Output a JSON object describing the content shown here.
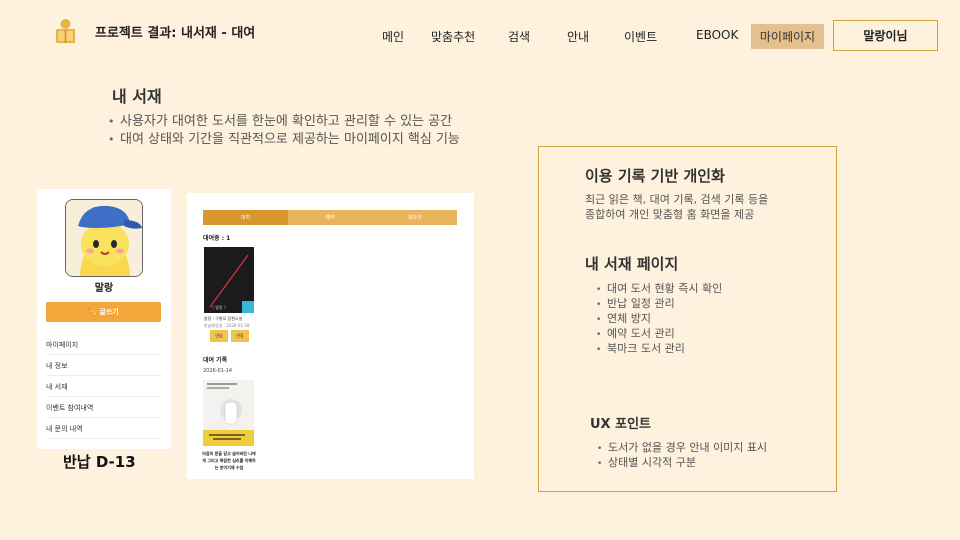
{
  "header": {
    "title": "프로젝트 결과: 내서재 - 대여",
    "nav": [
      "메인",
      "맞춤추천",
      "검색",
      "안내",
      "이벤트",
      "EBOOK"
    ],
    "mypage_label": "마이페이지",
    "user_label": "말랑이님"
  },
  "section": {
    "title": "내 서재",
    "bullets": [
      "사용자가 대여한 도서를 한눈에 확인하고 관리할 수 있는 공간",
      "대여 상태와 기간을 직관적으로 제공하는 마이페이지 핵심 기능"
    ]
  },
  "profile": {
    "name": "말랑",
    "write_label": "✏️ 글쓰기",
    "menu": [
      "마이페이지",
      "내 정보",
      "내 서재",
      "이벤트 참여내역",
      "내 문의 내역"
    ],
    "return_badge": "반납 D-13"
  },
  "library": {
    "tabs": [
      "대여",
      "예약",
      "북마크"
    ],
    "lend_count": "대여중 : 1",
    "book1_title": "말랑 : 구병모 장편소설",
    "book1_date": "반납예정일 : 2026-01-28",
    "return_btn": "반납",
    "extend_btn": "연장",
    "history_title": "대여 기록",
    "history_date": "2026-01-14",
    "book2_title": "마음의 문을 닫고 숨어버린 나에게 그리고 복잡한 심리를 이해하는 방어기제 수업"
  },
  "info": {
    "h1": "이용 기록 기반 개인화",
    "p1": [
      "최근 읽은 책, 대여 기록, 검색 기록 등을",
      "종합하여 개인 맞춤형 홈 화면을 제공"
    ],
    "h2": "내 서재 페이지",
    "list2": [
      "대여 도서 현황 즉시 확인",
      "반납 일정 관리",
      "연체 방지",
      "예약 도서 관리",
      "북마크 도서 관리"
    ],
    "h3": "UX 포인트",
    "list3": [
      "도서가 없을 경우 안내 이미지 표시",
      "상태별 시각적 구분"
    ]
  },
  "colors": {
    "background": "#fef1dd",
    "accent": "#d2a33c",
    "tab_active": "#d8962f",
    "tab": "#e9b55c",
    "write_button": "#f3a73a"
  }
}
